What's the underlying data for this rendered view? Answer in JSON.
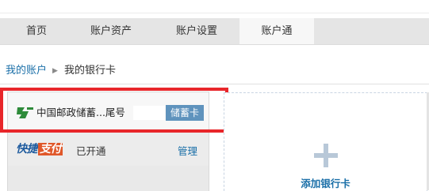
{
  "nav": {
    "tabs": [
      {
        "label": "首页",
        "active": false
      },
      {
        "label": "账户资产",
        "active": false
      },
      {
        "label": "账户设置",
        "active": false
      },
      {
        "label": "账户通",
        "active": true
      }
    ]
  },
  "breadcrumb": {
    "parent": "我的账户",
    "separator": "▶",
    "current": "我的银行卡"
  },
  "bank_card": {
    "bank_name": "中国邮政储蓄...尾号",
    "card_type": "储蓄卡",
    "logo_icon": "postal-bank-icon",
    "quick_pay": {
      "logo_part1": "快捷",
      "logo_part2": "支付",
      "status": "已开通",
      "manage_label": "管理"
    }
  },
  "add_card": {
    "icon": "plus-icon",
    "label": "添加银行卡"
  },
  "colors": {
    "highlight": "#e8262a",
    "link": "#1a6fa8",
    "badge": "#5f93bd",
    "brand_orange": "#e0582a"
  }
}
